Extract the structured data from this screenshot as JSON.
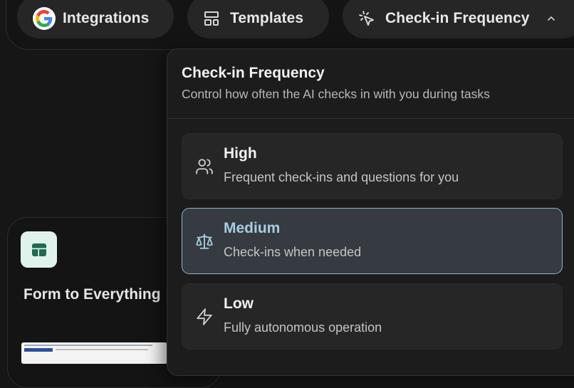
{
  "toolbar": {
    "integrations_label": "Integrations",
    "templates_label": "Templates",
    "checkin_label": "Check-in Frequency",
    "icons": {
      "integrations": "google-logo-icon",
      "templates": "layout-template-icon",
      "checkin": "cursor-click-icon",
      "toggle": "chevron-up-icon"
    }
  },
  "background_card": {
    "title": "Form to Everything",
    "icon": "table-icon"
  },
  "checkin_menu": {
    "title": "Check-in Frequency",
    "subtitle": "Control how often the AI checks in with you during tasks",
    "selected": "Medium",
    "options": [
      {
        "label": "High",
        "description": "Frequent check-ins and questions for you",
        "icon": "users-icon"
      },
      {
        "label": "Medium",
        "description": "Check-ins when needed",
        "icon": "scale-icon"
      },
      {
        "label": "Low",
        "description": "Fully autonomous operation",
        "icon": "lightning-icon"
      }
    ]
  },
  "colors": {
    "background": "#161616",
    "pill": "#262626",
    "panel": "#1c1c1c",
    "selected_border": "#8fb4c6",
    "selected_text": "#a8cde0",
    "table_icon_bg": "#dff3ec"
  }
}
